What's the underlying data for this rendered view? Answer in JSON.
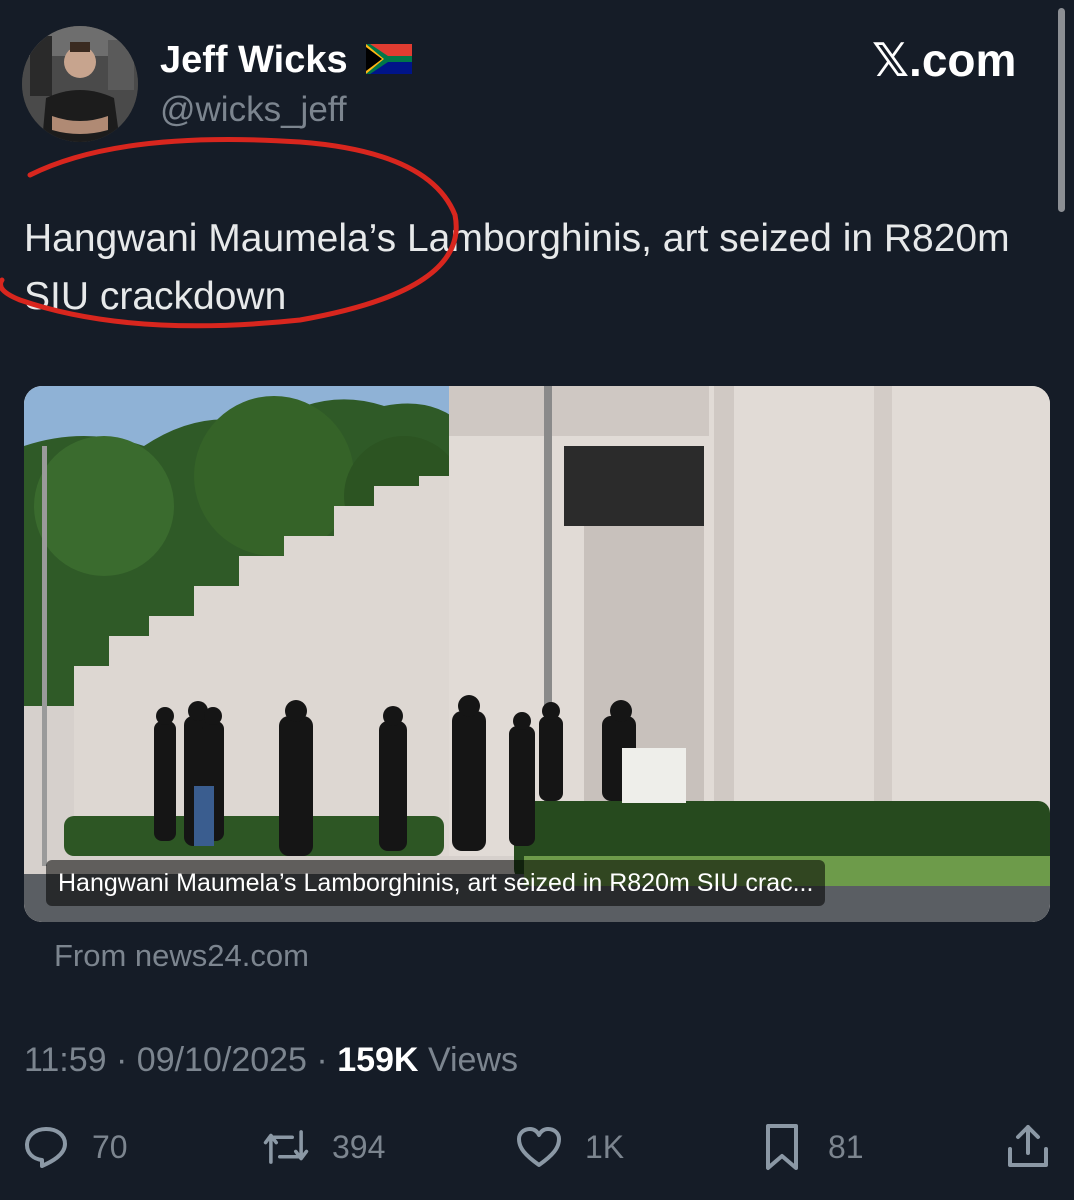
{
  "author": {
    "display_name": "Jeff Wicks",
    "handle": "@wicks_jeff",
    "flag_icon": "south-africa-flag-icon"
  },
  "brand": "𝕏.com",
  "tweet": {
    "text": "Hangwani Maumela’s Lamborghinis, art seized in R820m SIU crackdown"
  },
  "link_card": {
    "title": "Hangwani Maumela’s Lamborghinis, art seized in R820m SIU crac...",
    "source": "From news24.com"
  },
  "meta": {
    "time": "11:59",
    "date": "09/10/2025",
    "separator": "·",
    "views_count": "159K",
    "views_label": "Views"
  },
  "actions": {
    "replies": "70",
    "reposts": "394",
    "likes": "1K",
    "bookmarks": "81"
  },
  "colors": {
    "background": "#151c27",
    "text": "#e7e9ea",
    "muted": "#7c858f",
    "annotation": "#d8261e"
  }
}
